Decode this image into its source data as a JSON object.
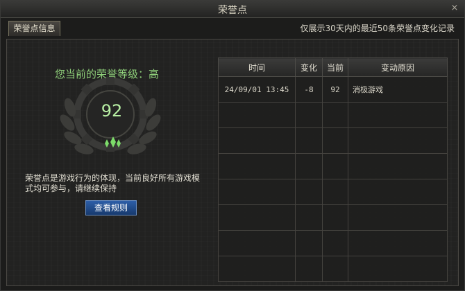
{
  "window": {
    "title": "荣誉点",
    "close_glyph": "×"
  },
  "tab": {
    "label": "荣誉点信息"
  },
  "notice": "仅展示30天内的最近50条荣誉点变化记录",
  "honor": {
    "level_text": "您当前的荣誉等级：高",
    "score": "92",
    "description": "荣誉点是游戏行为的体现，当前良好所有游戏模式均可参与，请继续保持",
    "rules_button": "查看规则",
    "emblem_icon": "laurel-gear-emblem-icon",
    "accent_color": "#8fd07a"
  },
  "table": {
    "headers": [
      "时间",
      "变化",
      "当前",
      "变动原因"
    ],
    "rows": [
      [
        "24/09/01 13:45",
        "-8",
        "92",
        "消极游戏"
      ],
      [
        "",
        "",
        "",
        ""
      ],
      [
        "",
        "",
        "",
        ""
      ],
      [
        "",
        "",
        "",
        ""
      ],
      [
        "",
        "",
        "",
        ""
      ],
      [
        "",
        "",
        "",
        ""
      ],
      [
        "",
        "",
        "",
        ""
      ],
      [
        "",
        "",
        "",
        ""
      ]
    ]
  }
}
